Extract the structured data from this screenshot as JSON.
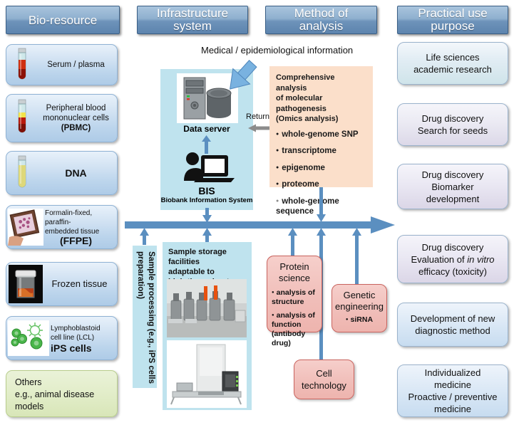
{
  "columns": [
    {
      "id": "bio-resource",
      "title": "Bio-resource"
    },
    {
      "id": "infrastructure",
      "title": "Infrastructure\nsystem",
      "line1": "Infrastructure",
      "line2": "system"
    },
    {
      "id": "method",
      "title": "Method of\nanalysis",
      "line1": "Method of",
      "line2": "analysis"
    },
    {
      "id": "practical",
      "title": "Practical use\npurpose",
      "line1": "Practical use",
      "line2": "purpose"
    }
  ],
  "bio_resources": [
    {
      "id": "serum",
      "label": "Serum / plasma",
      "icon": "test-tube-red"
    },
    {
      "id": "pbmc",
      "line1": "Peripheral blood",
      "line2": "mononuclear cells",
      "line3": "(PBMC)",
      "icon": "test-tube-layered"
    },
    {
      "id": "dna",
      "label": "DNA",
      "icon": "test-tube-yellow"
    },
    {
      "id": "ffpe",
      "line1": "Formalin-fixed, paraffin-",
      "line2": "embedded tissue",
      "line3": "(FFPE)",
      "icon": "tissue-slide"
    },
    {
      "id": "frozen",
      "label": "Frozen tissue",
      "icon": "frozen-jar"
    },
    {
      "id": "ips",
      "line1": "Lymphoblastoid",
      "line2": "cell line (LCL)",
      "line3": "iPS cells",
      "icon": "cells"
    }
  ],
  "others_box": {
    "line1": "Others",
    "line2": "e.g., animal disease",
    "line3": "models"
  },
  "infrastructure": {
    "data_server_label": "Data server",
    "bis_label": "BIS",
    "bis_sub": "Biobank Information System",
    "incoming_text": "Medical / epidemiological information",
    "return_label": "Return"
  },
  "omics": {
    "head_line1": "Comprehensive analysis",
    "head_line2": "of molecular pathogenesis",
    "head_line3": "(Omics analysis)",
    "items": [
      {
        "label": "whole-genome SNP",
        "dim": false
      },
      {
        "label": "transcriptome",
        "dim": false
      },
      {
        "label": "epigenome",
        "dim": false
      },
      {
        "label": "proteome",
        "dim": false
      },
      {
        "label": "whole-genome sequence",
        "dim": true
      }
    ]
  },
  "sample_processing": {
    "line1": "Sample processing",
    "line2": "(e.g., iPS cells preparation)",
    "full": "Sample processing (e.g., iPS cells preparation)"
  },
  "storage": {
    "line1": "Sample storage facilities",
    "line2": "adaptable to",
    "line3": "high-throughput system"
  },
  "technologies": [
    {
      "id": "protein-science",
      "title_line1": "Protein",
      "title_line2": "science",
      "bullets": [
        {
          "lines": [
            "analysis of",
            "structure"
          ]
        },
        {
          "lines": [
            "analysis of",
            "function",
            "(antibody drug)"
          ]
        }
      ]
    },
    {
      "id": "genetic-engineering",
      "title_line1": "Genetic",
      "title_line2": "engineering",
      "bullets": [
        {
          "lines": [
            "siRNA"
          ]
        }
      ]
    },
    {
      "id": "cell-technology",
      "title_line1": "Cell",
      "title_line2": "technology",
      "bullets": []
    }
  ],
  "practical_uses": [
    {
      "id": "life-sciences",
      "lines": [
        "Life sciences",
        "academic research"
      ]
    },
    {
      "id": "drug-seeds",
      "lines": [
        "Drug discovery",
        "Search for seeds"
      ]
    },
    {
      "id": "biomarker",
      "lines": [
        "Drug discovery",
        "Biomarker",
        "development"
      ]
    },
    {
      "id": "in-vitro",
      "lines": [
        "Drug discovery",
        "Evaluation of ",
        "in vitro",
        "efficacy (toxicity)"
      ],
      "italic_part": "in vitro"
    },
    {
      "id": "diagnostic",
      "lines": [
        "Development of new",
        "diagnostic method"
      ]
    },
    {
      "id": "individualized",
      "lines": [
        "Individualized",
        "medicine",
        "Proactive / preventive",
        "medicine"
      ]
    }
  ],
  "colors": {
    "header_blue": "#5d84ae",
    "arrow_blue": "#5b8fc0",
    "panel_cyan": "#bfe3ee",
    "omics_peach": "#fbdfca",
    "pink": "#f0bdb8",
    "green": "#e2edc9",
    "return_gray": "#8c8c8c"
  }
}
